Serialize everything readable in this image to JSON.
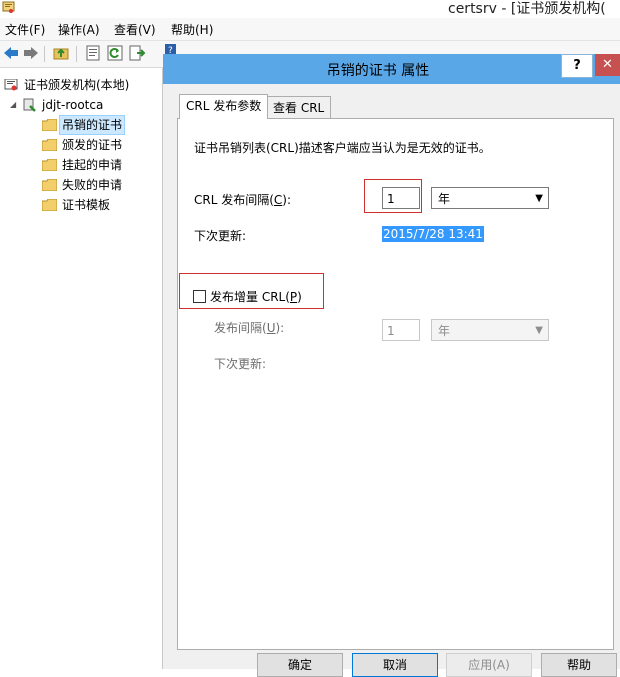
{
  "window": {
    "title": "certsrv - [证书颁发机构("
  },
  "menubar": {
    "file": "文件(F)",
    "action": "操作(A)",
    "view": "查看(V)",
    "help": "帮助(H)"
  },
  "toolbar": {
    "buttons": [
      "back-icon",
      "forward-icon",
      "up-folder-icon",
      "properties-icon",
      "refresh-icon",
      "export-list-icon"
    ]
  },
  "tree": {
    "root": "证书颁发机构(本地)",
    "ca": "jdjt-rootca",
    "items": [
      "吊销的证书",
      "颁发的证书",
      "挂起的申请",
      "失败的申请",
      "证书模板"
    ],
    "selected_index": 0
  },
  "dialog": {
    "title": "吊销的证书 属性",
    "help_label": "?",
    "close_label": "✕",
    "tabs": [
      "CRL 发布参数",
      "查看 CRL"
    ],
    "active_tab": 0,
    "description": "证书吊销列表(CRL)描述客户端应当认为是无效的证书。",
    "crl_interval_label_pre": "CRL 发布间隔(",
    "crl_interval_key": "C",
    "crl_interval_label_post": "):",
    "crl_interval_value": "1",
    "crl_interval_unit": "年",
    "next_update_label": "下次更新:",
    "next_update_value": "2015/7/28 13:41",
    "delta_checkbox_pre": "发布增量 CRL(",
    "delta_checkbox_key": "P",
    "delta_checkbox_post": ")",
    "delta_checked": false,
    "delta_interval_label_pre": "发布间隔(",
    "delta_interval_key": "U",
    "delta_interval_label_post": "):",
    "delta_interval_value": "1",
    "delta_interval_unit": "年",
    "delta_next_update_label": "下次更新:",
    "buttons": {
      "ok": "确定",
      "cancel": "取消",
      "apply": "应用(A)",
      "help": "帮助"
    }
  },
  "colors": {
    "dialog_titlebar": "#5aa7e8",
    "selection": "#3399ff",
    "annotation_red": "#d32f2f"
  }
}
